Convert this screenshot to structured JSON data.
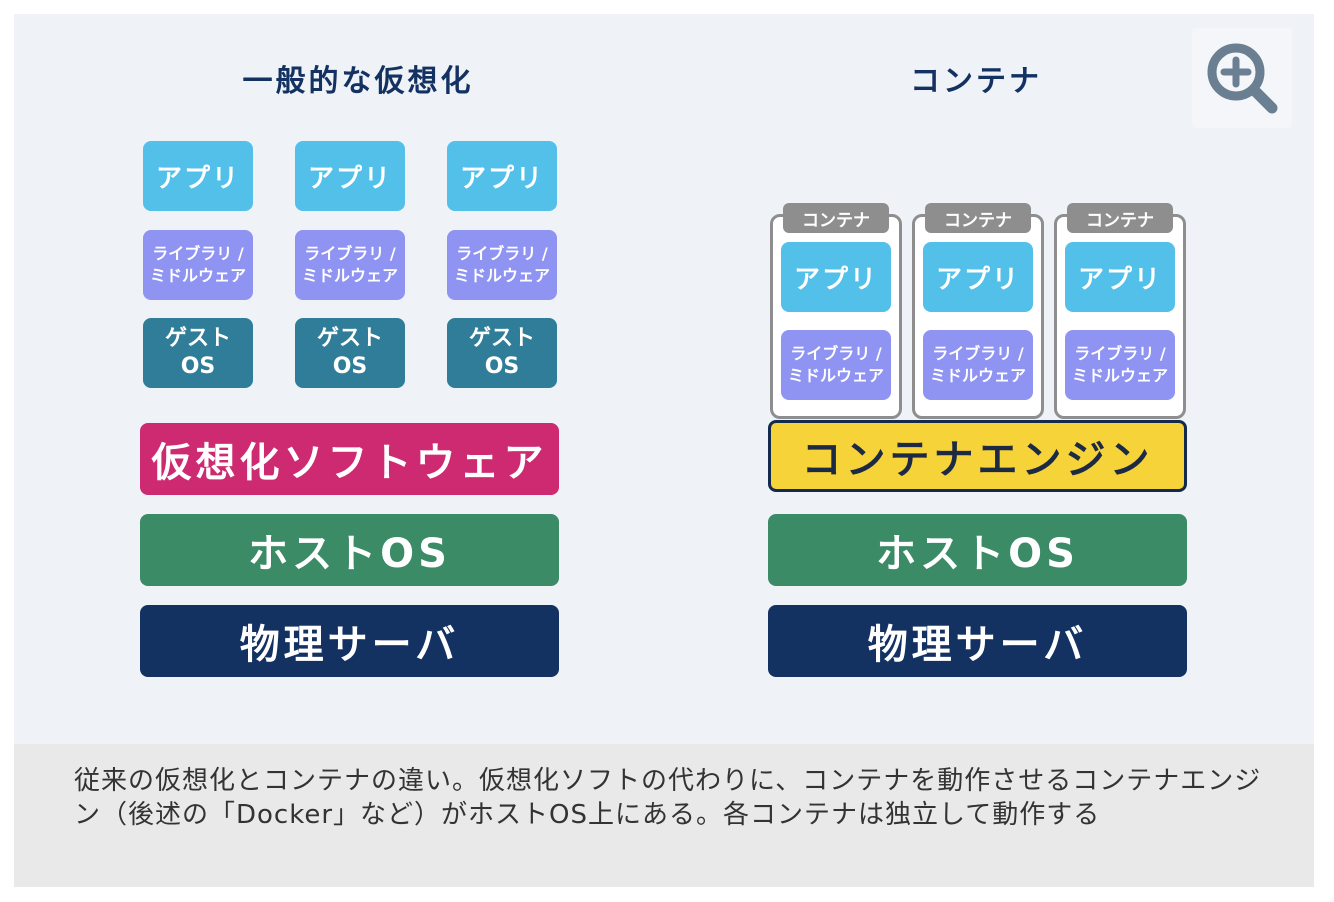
{
  "left": {
    "title": "一般的な仮想化",
    "stacks": [
      {
        "app": "アプリ",
        "lib": "ライブラリ /\nミドルウェア",
        "guest": "ゲスト\nOS"
      },
      {
        "app": "アプリ",
        "lib": "ライブラリ /\nミドルウェア",
        "guest": "ゲスト\nOS"
      },
      {
        "app": "アプリ",
        "lib": "ライブラリ /\nミドルウェア",
        "guest": "ゲスト\nOS"
      }
    ],
    "virtualization_software": "仮想化ソフトウェア",
    "host_os": "ホストOS",
    "physical_server": "物理サーバ"
  },
  "right": {
    "title": "コンテナ",
    "containers": [
      {
        "label": "コンテナ",
        "app": "アプリ",
        "lib": "ライブラリ /\nミドルウェア"
      },
      {
        "label": "コンテナ",
        "app": "アプリ",
        "lib": "ライブラリ /\nミドルウェア"
      },
      {
        "label": "コンテナ",
        "app": "アプリ",
        "lib": "ライブラリ /\nミドルウェア"
      }
    ],
    "container_engine": "コンテナエンジン",
    "host_os": "ホストOS",
    "physical_server": "物理サーバ"
  },
  "zoom": {
    "icon": "zoom-in-icon",
    "color": "#6a7f92"
  },
  "caption": "従来の仮想化とコンテナの違い。仮想化ソフトの代わりに、コンテナを動作させるコンテナエンジン（後述の「Docker」など）がホストOS上にある。各コンテナは独立して動作する",
  "colors": {
    "app": "#53c0ea",
    "library": "#8f93f2",
    "guest_os": "#2f7d98",
    "virtualization": "#cd2a72",
    "engine": "#f7d33a",
    "host_os": "#3b8b67",
    "physical": "#133161",
    "container_frame": "#8e8e8e"
  }
}
